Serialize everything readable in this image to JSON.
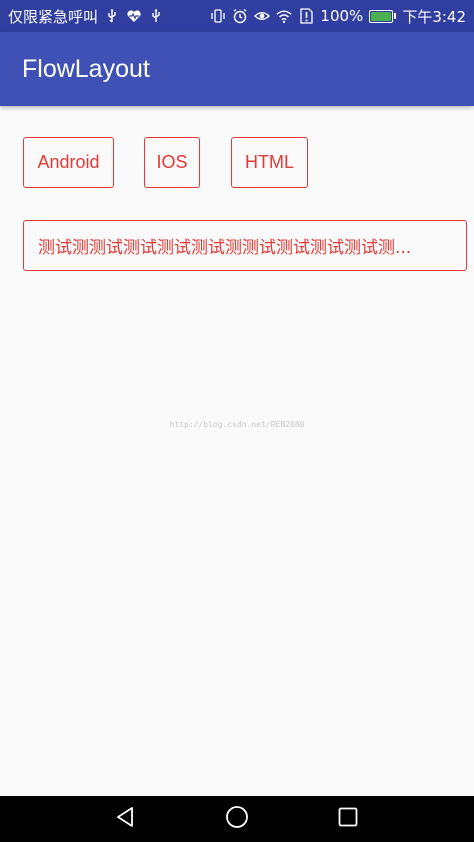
{
  "status_bar": {
    "left_text": "仅限紧急呼叫",
    "battery": "100%",
    "time": "下午3:42",
    "battery_level": 1.0,
    "icons": [
      "usb-icon",
      "health-icon",
      "usb-icon",
      "vibrate-icon",
      "alarm-icon",
      "eye-icon",
      "wifi-icon",
      "no-sim-icon",
      "battery-icon"
    ]
  },
  "app_bar": {
    "title": "FlowLayout"
  },
  "tags": [
    {
      "label": "Android"
    },
    {
      "label": "IOS"
    },
    {
      "label": "HTML"
    },
    {
      "label": "测试测测试测试测试测试测测试测试测试测试测..."
    }
  ],
  "watermark": "http://blog.csdn.net/REN2080",
  "colors": {
    "status_bar": "#303F9F",
    "app_bar": "#3F51B5",
    "tag_border": "#e53935",
    "tag_text": "#e53935",
    "background": "#fafafa"
  },
  "nav_bar": {
    "icons": [
      "back-icon",
      "home-icon",
      "recents-icon"
    ]
  }
}
